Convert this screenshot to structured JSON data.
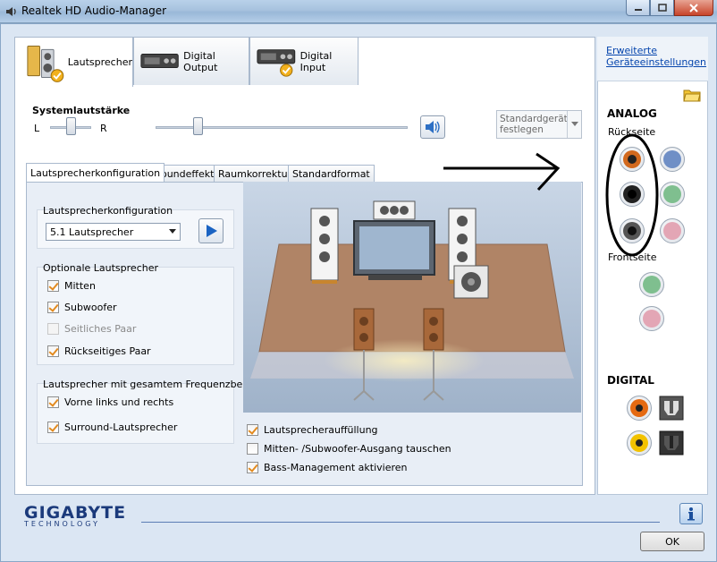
{
  "window": {
    "title": "Realtek HD Audio-Manager"
  },
  "device_tabs": [
    {
      "label": "Lautsprecher"
    },
    {
      "label": "Digital Output"
    },
    {
      "label": "Digital Input"
    }
  ],
  "volume": {
    "label": "Systemlautstärke",
    "left": "L",
    "right": "R",
    "balance_level": 0.5,
    "volume_level": 0.17
  },
  "default_device": {
    "label": "Standardgerät festlegen"
  },
  "sub_tabs": [
    {
      "label": "Lautsprecherkonfiguration"
    },
    {
      "label": "Soundeffekt"
    },
    {
      "label": "Raumkorrektur"
    },
    {
      "label": "Standardformat"
    }
  ],
  "config": {
    "group_title": "Lautsprecherkonfiguration",
    "selected": "5.1 Lautsprecher"
  },
  "optional": {
    "title": "Optionale Lautsprecher",
    "items": [
      {
        "label": "Mitten",
        "checked": true,
        "disabled": false
      },
      {
        "label": "Subwoofer",
        "checked": true,
        "disabled": false
      },
      {
        "label": "Seitliches Paar",
        "checked": false,
        "disabled": true
      },
      {
        "label": "Rückseitiges Paar",
        "checked": true,
        "disabled": false
      }
    ]
  },
  "fullrange": {
    "title": "Lautsprecher mit gesamtem Frequenzbereich",
    "items": [
      {
        "label": "Vorne links und rechts",
        "checked": true
      },
      {
        "label": "Surround-Lautsprecher",
        "checked": true
      }
    ]
  },
  "bottom_options": [
    {
      "label": "Lautsprecherauffüllung",
      "checked": true
    },
    {
      "label": "Mitten- /Subwoofer-Ausgang tauschen",
      "checked": false
    },
    {
      "label": "Bass-Management aktivieren",
      "checked": true
    }
  ],
  "right": {
    "advanced_link_1": "Erweiterte",
    "advanced_link_2": "Geräteeinstellungen",
    "analog": "ANALOG",
    "rear": "Rückseite",
    "front": "Frontseite",
    "digital": "DIGITAL"
  },
  "footer": {
    "brand": "GIGABYTE",
    "brand_sub": "TECHNOLOGY",
    "ok": "OK"
  },
  "colors": {
    "accent_orange": "#e28a1f",
    "jack_orange": "#d2691e",
    "jack_black": "#222222",
    "jack_grey": "#555555",
    "jack_blue": "#6f8fc6",
    "jack_green": "#7fbf8f",
    "jack_pink": "#e3a6b5",
    "brand_blue": "#1b3a7b"
  }
}
